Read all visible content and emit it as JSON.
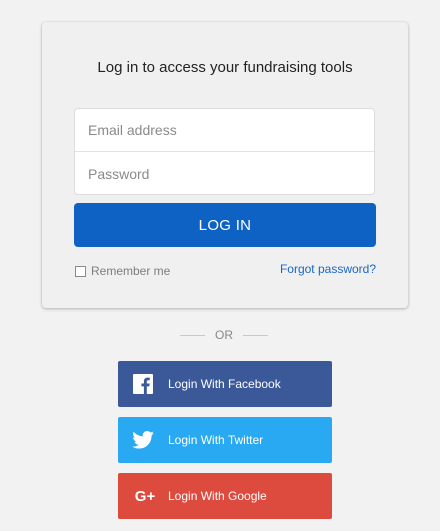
{
  "card": {
    "title": "Log in to access your fundraising tools",
    "email_placeholder": "Email address",
    "password_placeholder": "Password",
    "login_label": "LOG IN",
    "remember_label": "Remember me",
    "remember_checked": false,
    "forgot_label": "Forgot password?"
  },
  "divider": {
    "label": "OR"
  },
  "social": {
    "facebook": {
      "label": "Login With Facebook",
      "icon": "facebook-icon",
      "color": "#3b5998"
    },
    "twitter": {
      "label": "Login With Twitter",
      "icon": "twitter-icon",
      "color": "#2aa9f3"
    },
    "google": {
      "label": "Login With Google",
      "icon": "google-plus-icon",
      "glyph": "G+",
      "color": "#dd4b3e"
    }
  },
  "colors": {
    "login_button": "#0e62c4",
    "link": "#1a66c7"
  }
}
